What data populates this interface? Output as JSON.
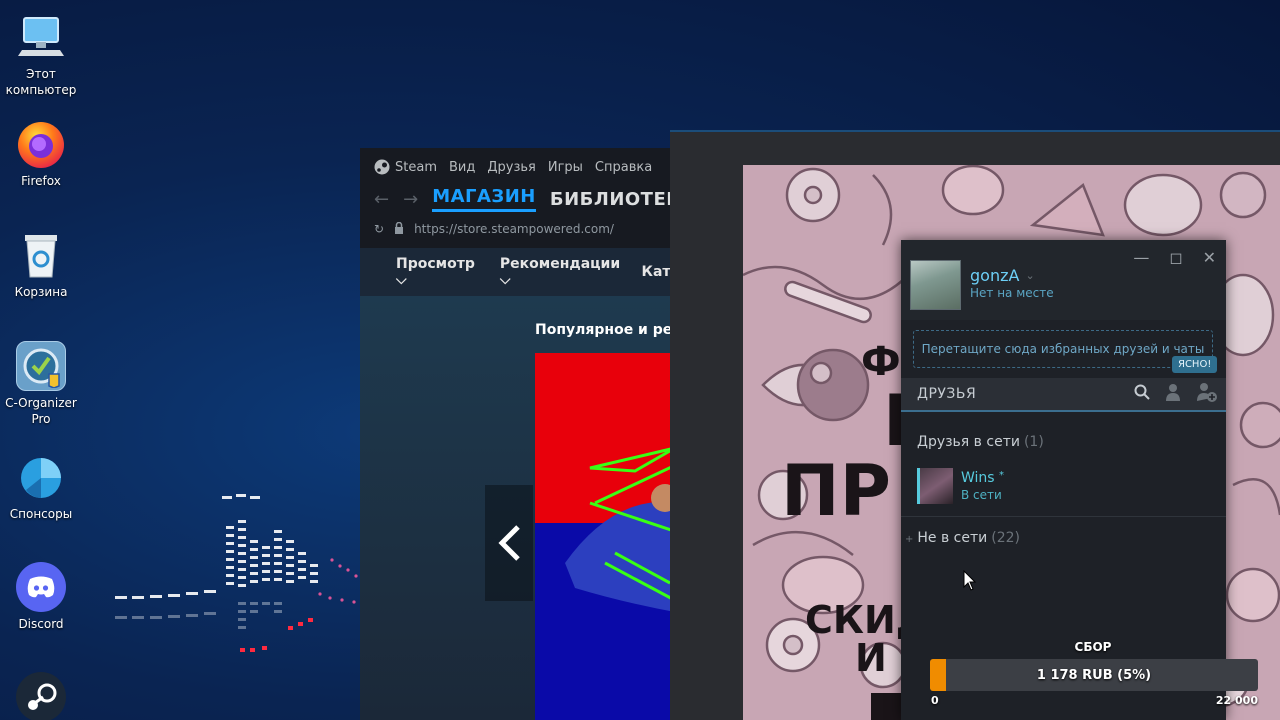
{
  "desktop": {
    "icons": [
      {
        "label": "Этот\nкомпьютер",
        "icon": "computer-icon"
      },
      {
        "label": "Firefox",
        "icon": "firefox-icon"
      },
      {
        "label": "Корзина",
        "icon": "recycle-bin-icon"
      },
      {
        "label": "C-Organizer\nPro",
        "icon": "c-organizer-icon"
      },
      {
        "label": "Спонсоры",
        "icon": "sponsors-icon"
      },
      {
        "label": "Discord",
        "icon": "discord-icon"
      },
      {
        "label": "",
        "icon": "steam-icon"
      }
    ]
  },
  "store": {
    "menu": [
      "Steam",
      "Вид",
      "Друзья",
      "Игры",
      "Справка"
    ],
    "tabs": [
      "МАГАЗИН",
      "БИБЛИОТЕК"
    ],
    "url": "https://store.steampowered.com/",
    "nav": [
      "Просмотр",
      "Рекомендации",
      "Кате"
    ],
    "heading": "Популярное и реко"
  },
  "banner": {
    "lines": [
      "Ф",
      "Г",
      "ПР",
      "СКИД",
      "И"
    ]
  },
  "friends": {
    "user_name": "gonzA",
    "user_status": "Нет на месте",
    "drop_hint": "Перетащите сюда избранных друзей и чаты",
    "ok_label": "ЯСНО!",
    "section_title": "ДРУЗЬЯ",
    "online_group": {
      "label": "Друзья в сети",
      "count": "(1)"
    },
    "friend": {
      "name": "Wins",
      "status": "В сети"
    },
    "offline_group": {
      "label": "Не в сети",
      "count": "(22)"
    }
  },
  "donation": {
    "title": "СБОР",
    "amount": "1 178 RUB (5%)",
    "progress_percent": 5,
    "min": "0",
    "max": "22 000",
    "fill_color": "#f08c00"
  },
  "colors": {
    "steam_blue": "#1a9fff",
    "online_cyan": "#57cbde",
    "self_blue": "#6dcff6"
  }
}
